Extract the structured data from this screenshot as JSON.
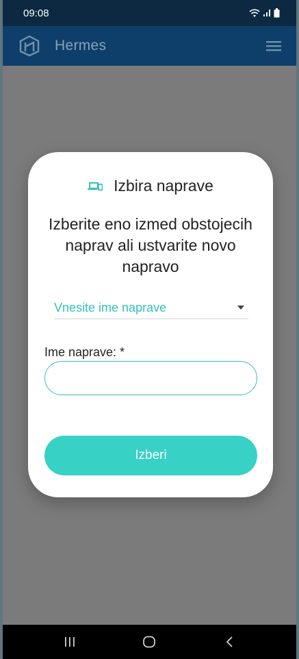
{
  "status_bar": {
    "time": "09:08",
    "icons": [
      "wifi-icon",
      "signal-icon",
      "battery-icon"
    ]
  },
  "app_bar": {
    "title": "Hermes",
    "logo_icon": "hermes-logo-icon",
    "menu_icon": "hamburger-menu-icon"
  },
  "dialog": {
    "title": "Izbira naprave",
    "title_icon": "devices-icon",
    "message": "Izberite eno izmed obstojecih naprav ali ustvarite novo napravo",
    "select": {
      "placeholder": "Vnesite ime naprave"
    },
    "name_field": {
      "label": "Ime naprave: *",
      "value": ""
    },
    "submit_label": "Izberi"
  },
  "nav_bar": {
    "icons": [
      "recents-icon",
      "home-icon",
      "back-icon"
    ]
  },
  "colors": {
    "status_bar": "#0c2941",
    "app_bar": "#0e3f6b",
    "accent": "#37d1c5",
    "overlay": "#7b7b7b"
  }
}
